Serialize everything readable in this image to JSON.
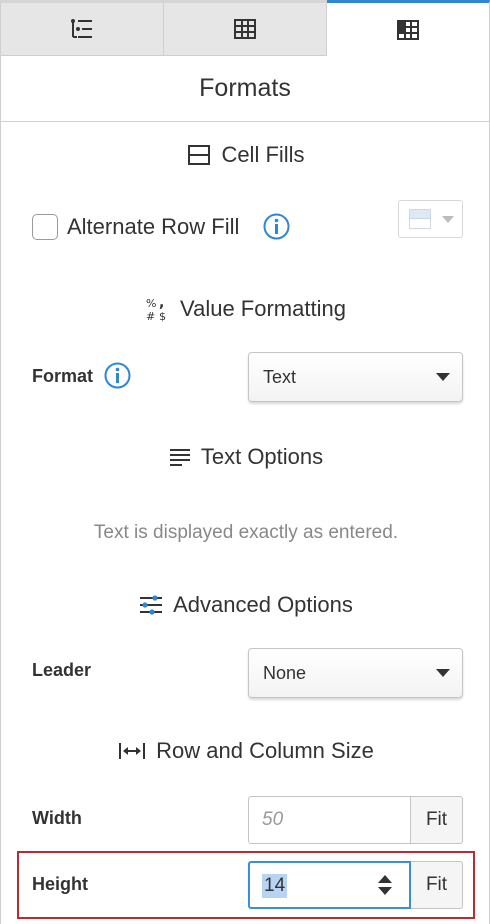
{
  "tabs": [
    {
      "icon": "list-tree-icon",
      "active": false
    },
    {
      "icon": "table-grid-icon",
      "active": false
    },
    {
      "icon": "table-format-icon",
      "active": true
    }
  ],
  "panel": {
    "title": "Formats"
  },
  "cell_fills": {
    "heading": "Cell Fills",
    "icon": "cell-fill-icon",
    "alternate_row_fill_label": "Alternate Row Fill",
    "alternate_row_fill_checked": false,
    "color_picker_icon": "row-color-swatch-icon"
  },
  "value_formatting": {
    "heading": "Value Formatting",
    "icon": "value-format-icon",
    "format_label": "Format",
    "format_value": "Text"
  },
  "text_options": {
    "heading": "Text Options",
    "icon": "text-align-icon",
    "note": "Text is displayed exactly as entered."
  },
  "advanced_options": {
    "heading": "Advanced Options",
    "icon": "sliders-icon",
    "leader_label": "Leader",
    "leader_value": "None"
  },
  "row_column_size": {
    "heading": "Row and Column Size",
    "icon": "resize-width-icon",
    "width_label": "Width",
    "width_placeholder": "50",
    "width_fit_label": "Fit",
    "height_label": "Height",
    "height_value": "14",
    "height_fit_label": "Fit"
  },
  "colors": {
    "accent": "#2f86d3",
    "info": "#2f86d3",
    "highlight_frame": "#c0292e",
    "focus": "#3b8fd9",
    "selection": "#b7d5f3"
  }
}
